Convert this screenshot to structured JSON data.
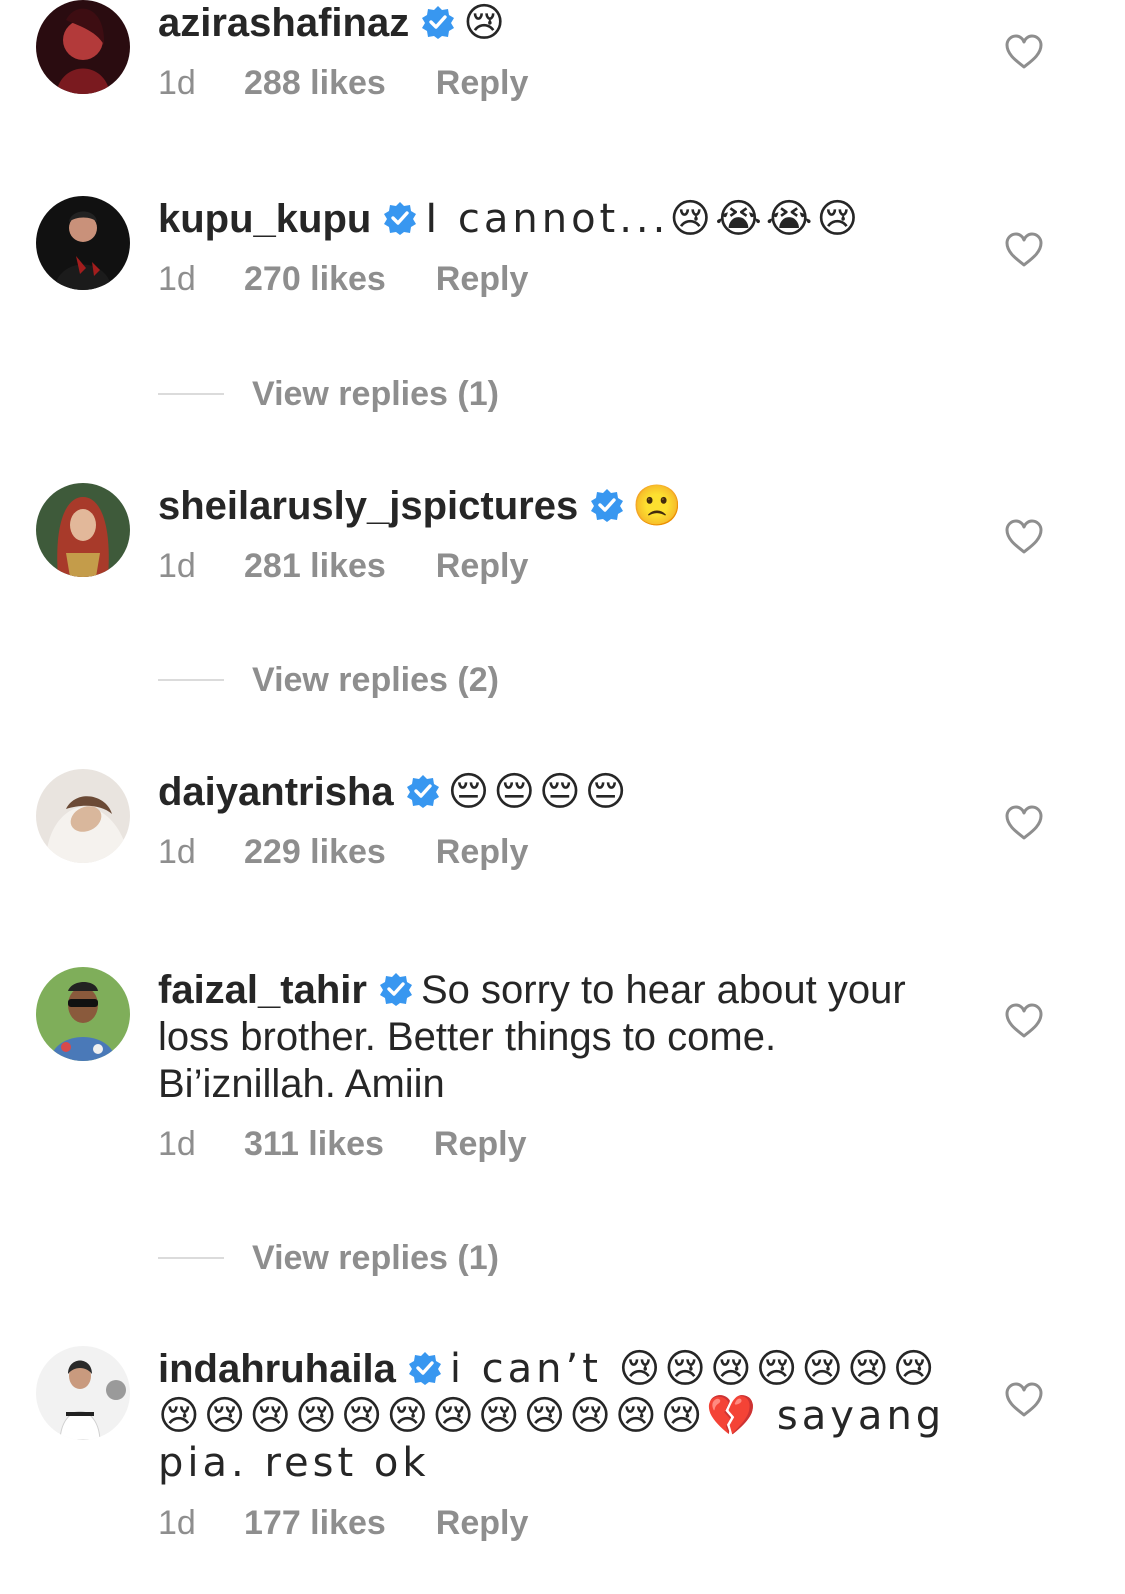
{
  "comments": [
    {
      "username": "azirashafinaz",
      "text": "😢",
      "time": "1d",
      "likes": "288 likes",
      "reply": "Reply"
    },
    {
      "username": "kupu_kupu",
      "text": "I cannot...😢😭😭😢",
      "time": "1d",
      "likes": "270 likes",
      "reply": "Reply",
      "view_replies": "View replies (1)"
    },
    {
      "username": "sheilarusly_jspictures",
      "text": "🙁",
      "time": "1d",
      "likes": "281 likes",
      "reply": "Reply",
      "view_replies": "View replies (2)"
    },
    {
      "username": "daiyantrisha",
      "text": "😔😔😔😔",
      "time": "1d",
      "likes": "229 likes",
      "reply": "Reply"
    },
    {
      "username": "faizal_tahir",
      "text": "So sorry to hear about your loss brother. Better things to come. Bi’iznillah. Amiin",
      "time": "1d",
      "likes": "311 likes",
      "reply": "Reply",
      "view_replies": "View replies (1)"
    },
    {
      "username": "indahruhaila",
      "text": "i can’t 😢😢😢😢😢😢😢😢😢😢😢😢😢😢😢😢😢😢😢💔 sayang pia. rest ok",
      "time": "1d",
      "likes": "177 likes",
      "reply": "Reply"
    }
  ],
  "icons": {
    "verified": "verified-badge-icon",
    "heart": "heart-outline-icon"
  },
  "colors": {
    "text": "#262626",
    "secondary": "#8e8e8e",
    "verified": "#3897f0",
    "divider": "#dbdbdb"
  }
}
